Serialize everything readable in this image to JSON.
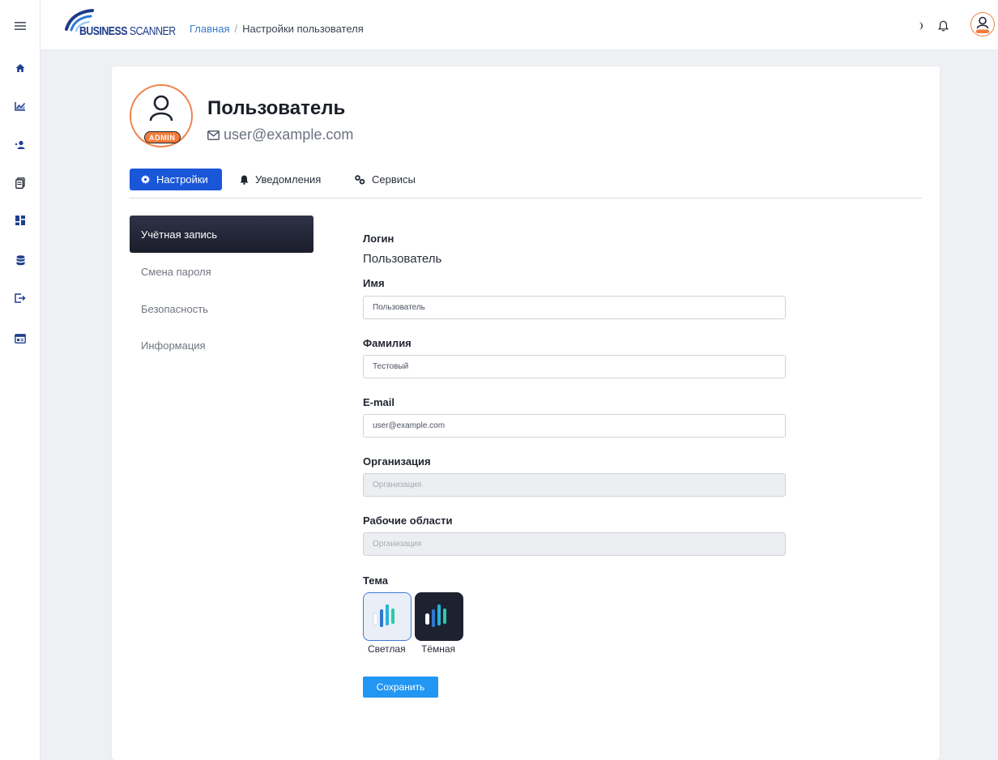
{
  "header": {
    "logo_bold": "BUSINESS",
    "logo_light": "SCANNER",
    "breadcrumb_home": "Главная",
    "breadcrumb_separator": "/",
    "breadcrumb_current": "Настройки пользователя",
    "avatar_badge": "ADMIN"
  },
  "sidebar": {
    "items": [
      {
        "icon": "menu-icon"
      },
      {
        "icon": "home-icon"
      },
      {
        "icon": "chart-icon"
      },
      {
        "icon": "users-icon"
      },
      {
        "icon": "reports-icon"
      },
      {
        "icon": "dashboard-icon"
      },
      {
        "icon": "database-icon"
      },
      {
        "icon": "logout-icon"
      },
      {
        "icon": "window-icon"
      }
    ]
  },
  "profile": {
    "name": "Пользователь",
    "email": "user@example.com",
    "badge": "ADMIN"
  },
  "tabs": [
    {
      "label": "Настройки",
      "icon": "gear-icon",
      "active": true
    },
    {
      "label": "Уведомления",
      "icon": "bell-icon",
      "active": false
    },
    {
      "label": "Сервисы",
      "icon": "services-icon",
      "active": false
    }
  ],
  "menu": [
    {
      "label": "Учётная запись",
      "active": true
    },
    {
      "label": "Смена пароля",
      "active": false
    },
    {
      "label": "Безопасность",
      "active": false
    },
    {
      "label": "Информация",
      "active": false
    }
  ],
  "form": {
    "login_label": "Логин",
    "login_value": "Пользователь",
    "first_name_label": "Имя",
    "first_name_value": "Пользователь",
    "last_name_label": "Фамилия",
    "last_name_value": "Тестовый",
    "email_label": "E-mail",
    "email_value": "user@example.com",
    "org_label": "Организация",
    "org_placeholder": "Организация",
    "workspaces_label": "Рабочие области",
    "workspaces_placeholder": "Организация",
    "theme_label": "Тема",
    "theme_light": "Светлая",
    "theme_dark": "Тёмная",
    "selected_theme": "Светлая",
    "save_label": "Сохранить"
  },
  "colors": {
    "primary": "#1a56d8",
    "save": "#2196f3",
    "accent_orange": "#f37a39",
    "menu_active": "#1b1d2a"
  }
}
